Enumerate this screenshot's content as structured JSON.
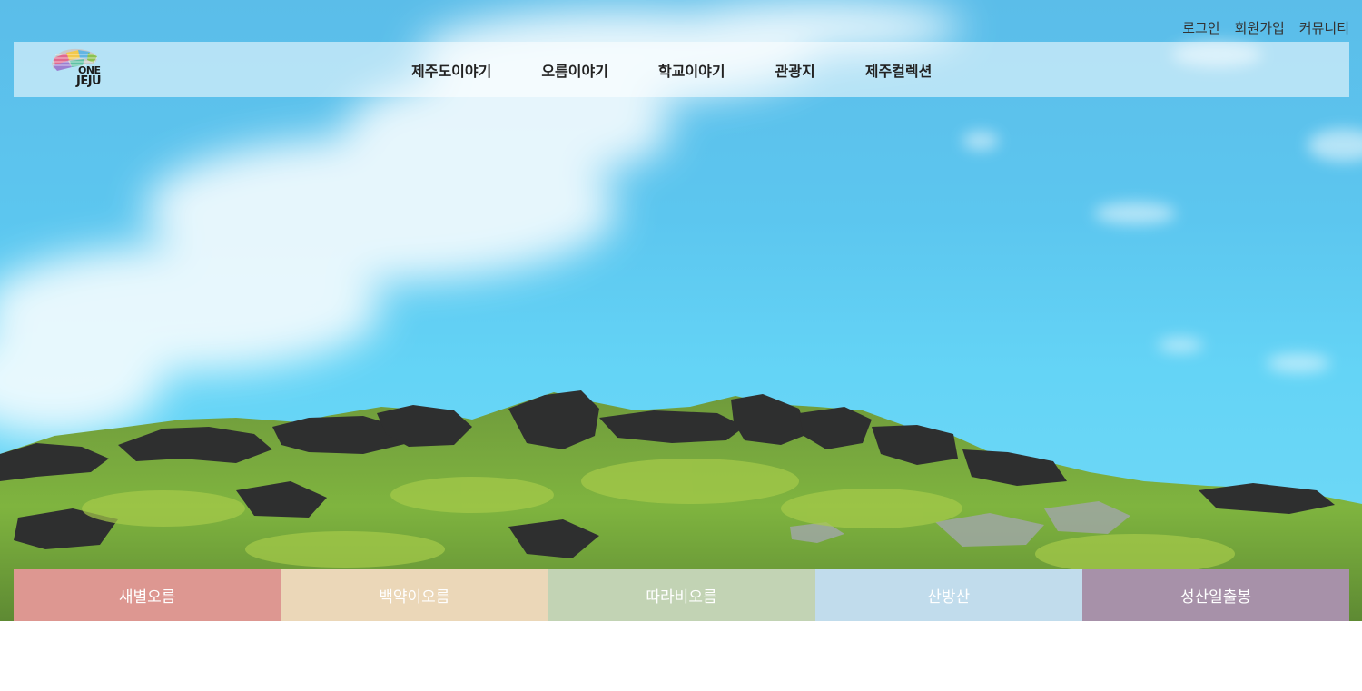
{
  "util_nav": [
    {
      "label": "로그인"
    },
    {
      "label": "회원가입"
    },
    {
      "label": "커뮤니티"
    }
  ],
  "logo": {
    "line1": "ONE",
    "line2": "JEJU"
  },
  "main_nav": [
    {
      "label": "제주도이야기"
    },
    {
      "label": "오름이야기"
    },
    {
      "label": "학교이야기"
    },
    {
      "label": "관광지"
    },
    {
      "label": "제주컬렉션"
    }
  ],
  "oreum_tabs": [
    {
      "label": "새별오름",
      "color": "#dd9791"
    },
    {
      "label": "백약이오름",
      "color": "#ebd7b8"
    },
    {
      "label": "따라비오름",
      "color": "#c2d3b4"
    },
    {
      "label": "산방산",
      "color": "#c1dcec"
    },
    {
      "label": "성산일출봉",
      "color": "#a791a9"
    }
  ]
}
